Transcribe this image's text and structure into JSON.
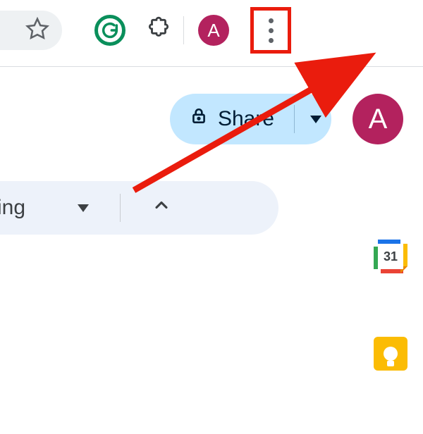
{
  "browser": {
    "avatar_initial": "A"
  },
  "app": {
    "share_label": "Share",
    "avatar_initial": "A"
  },
  "toolbar": {
    "mode_label_fragment": "ing"
  },
  "side": {
    "calendar_day": "31"
  },
  "annotation": {
    "arrow_color": "#ea1c0d"
  }
}
